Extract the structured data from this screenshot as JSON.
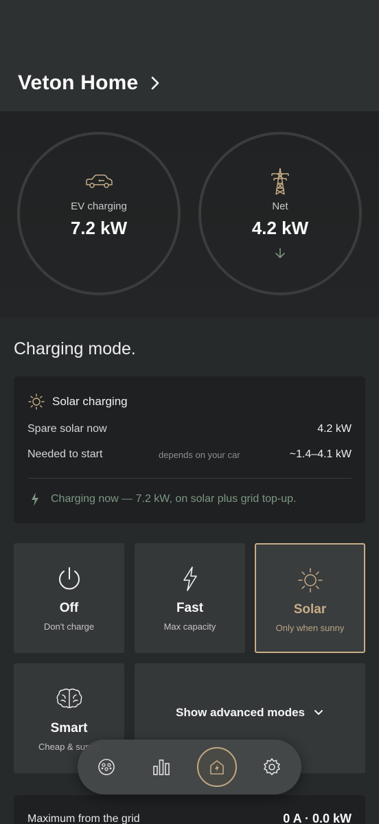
{
  "header": {
    "title": "Veton Home"
  },
  "gauges": [
    {
      "label": "EV charging",
      "value": "7.2 kW",
      "icon": "car-icon"
    },
    {
      "label": "Net",
      "value": "4.2 kW",
      "icon": "power-pylon-icon",
      "direction": "down-arrow-icon"
    }
  ],
  "charging_mode": {
    "section_title": "Charging mode.",
    "card": {
      "title": "Solar charging",
      "rows": [
        {
          "label": "Spare solar now",
          "hint": "",
          "value": "4.2 kW"
        },
        {
          "label": "Needed to start",
          "hint": "depends on your car",
          "value": "~1.4–4.1 kW"
        }
      ],
      "status": "Charging now — 7.2 kW, on solar plus grid top-up."
    },
    "modes": [
      {
        "title": "Off",
        "subtitle": "Don't charge",
        "icon": "power-icon"
      },
      {
        "title": "Fast",
        "subtitle": "Max capacity",
        "icon": "lightning-icon"
      },
      {
        "title": "Solar",
        "subtitle": "Only when sunny",
        "icon": "sun-icon",
        "selected": true
      },
      {
        "title": "Smart",
        "subtitle": "Cheap & sunny",
        "icon": "brain-icon"
      }
    ],
    "advanced_label": "Show advanced modes"
  },
  "grid_limit": {
    "label": "Maximum from the grid",
    "value": "0 A · 0.0 kW"
  },
  "bottom_nav": {
    "items": [
      "charger-plug-icon",
      "bar-chart-icon",
      "home-charger-icon",
      "settings-gear-icon"
    ],
    "active": "home-charger-icon"
  },
  "colors": {
    "accent": "#c7ad86",
    "status_green": "#7e9783",
    "background": "#272a2b",
    "card": "#1e2021",
    "tile": "#353839"
  }
}
